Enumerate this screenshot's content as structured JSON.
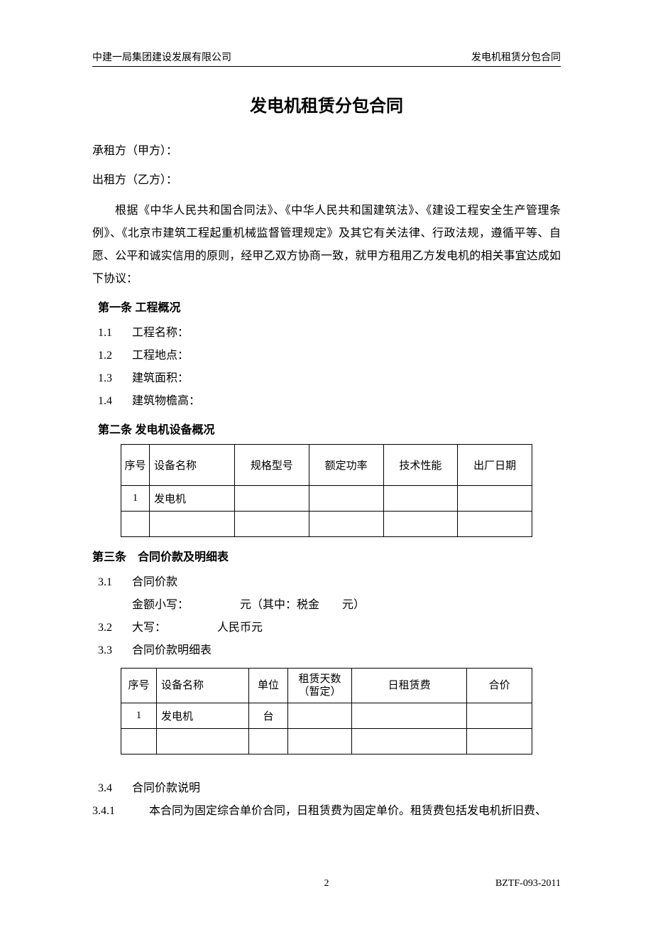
{
  "header": {
    "left": "中建一局集团建设发展有限公司",
    "right": "发电机租赁分包合同"
  },
  "title": "发电机租赁分包合同",
  "parties": {
    "a": "承租方（甲方）：",
    "b": "出租方（乙方）："
  },
  "intro": "根据《中华人民共和国合同法》、《中华人民共和国建筑法》、《建设工程安全生产管理条例》、《北京市建筑工程起重机械监督管理规定》及其它有关法律、行政法规，遵循平等、自愿、公平和诚实信用的原则，经甲乙双方协商一致，就甲方租用乙方发电机的相关事宜达成如下协议：",
  "art1": {
    "heading": "第一条 工程概况",
    "items": [
      {
        "num": "1.1",
        "label": "工程名称："
      },
      {
        "num": "1.2",
        "label": "工程地点："
      },
      {
        "num": "1.3",
        "label": "建筑面积："
      },
      {
        "num": "1.4",
        "label": "建筑物檐高："
      }
    ]
  },
  "art2": {
    "heading": "第二条 发电机设备概况",
    "table": {
      "headers": [
        "序号",
        "设备名称",
        "规格型号",
        "额定功率",
        "技术性能",
        "出厂日期"
      ],
      "rows": [
        [
          "1",
          "发电机",
          "",
          "",
          "",
          ""
        ],
        [
          "",
          "",
          "",
          "",
          "",
          ""
        ]
      ]
    }
  },
  "art3": {
    "heading": "第三条　合同价款及明细表",
    "i1": {
      "num": "3.1",
      "label": "合同价款"
    },
    "i1sub": "金额小写：　　　　　元（其中：税金　　元）",
    "i2": {
      "num": "3.2",
      "label": "大写：　　　　　人民币元"
    },
    "i3": {
      "num": "3.3",
      "label": "合同价款明细表"
    },
    "table": {
      "headers": [
        "序号",
        "设备名称",
        "单位",
        "租赁天数\n（暂定）",
        "日租赁费",
        "合价"
      ],
      "rows": [
        [
          "1",
          "发电机",
          "台",
          "",
          "",
          ""
        ],
        [
          "",
          "",
          "",
          "",
          "",
          ""
        ]
      ]
    },
    "i4": {
      "num": "3.4",
      "label": "合同价款说明"
    },
    "i41": {
      "num": "3.4.1",
      "text": "本合同为固定综合单价合同，日租赁费为固定单价。租赁费包括发电机折旧费、"
    }
  },
  "footer": {
    "page": "2",
    "code": "BZTF-093-2011"
  }
}
